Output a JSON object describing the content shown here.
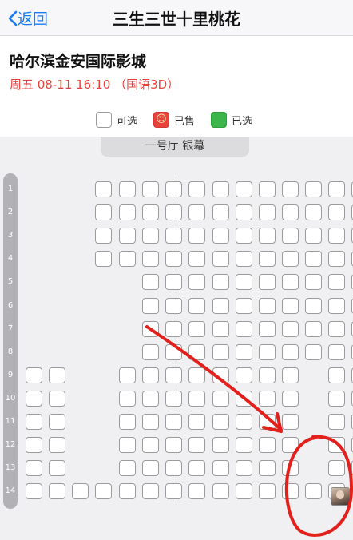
{
  "nav": {
    "back_label": "返回",
    "title": "三生三世十里桃花"
  },
  "cinema": {
    "name": "哈尔滨金安国际影城",
    "showtime": "周五 08-11 16:10 （国语3D）"
  },
  "legend": {
    "available": "可选",
    "sold": "已售",
    "selected": "已选"
  },
  "hall": {
    "label": "一号厅 银幕"
  },
  "colors": {
    "accent": "#1a7cf5",
    "sold": "#e8423c",
    "selected": "#3cb54a",
    "annotation": "#e3201b"
  },
  "rows": [
    {
      "label": "1",
      "seats": "-- XXXXXXXXXXXX"
    },
    {
      "label": "2",
      "seats": "-- XXXXXXXXXXXX"
    },
    {
      "label": "3",
      "seats": "-- XXXXXXXXXXXX"
    },
    {
      "label": "4",
      "seats": "-- XXXXXXXXXXXX"
    },
    {
      "label": "5",
      "seats": "-----XXXXXXXXXX"
    },
    {
      "label": "6",
      "seats": "-----XXXXXXXXXX"
    },
    {
      "label": "7",
      "seats": "-----XXXXXXXXXX"
    },
    {
      "label": "8",
      "seats": "-----XXXXXXXXXX"
    },
    {
      "label": "9",
      "seats": "XX--XXXXXXXX-XX"
    },
    {
      "label": "10",
      "seats": "XX--XXXXXXXX-XX"
    },
    {
      "label": "11",
      "seats": "XX--XXXXXXXX-XX"
    },
    {
      "label": "12",
      "seats": "XX--XXXXXXXX-XX"
    },
    {
      "label": "13",
      "seats": "XX--XXXXXXXX-XX"
    },
    {
      "label": "14",
      "seats": "XXXXXXXXXXXXXXA"
    }
  ],
  "special_seat": {
    "row": "14",
    "icon": "user-avatar"
  }
}
